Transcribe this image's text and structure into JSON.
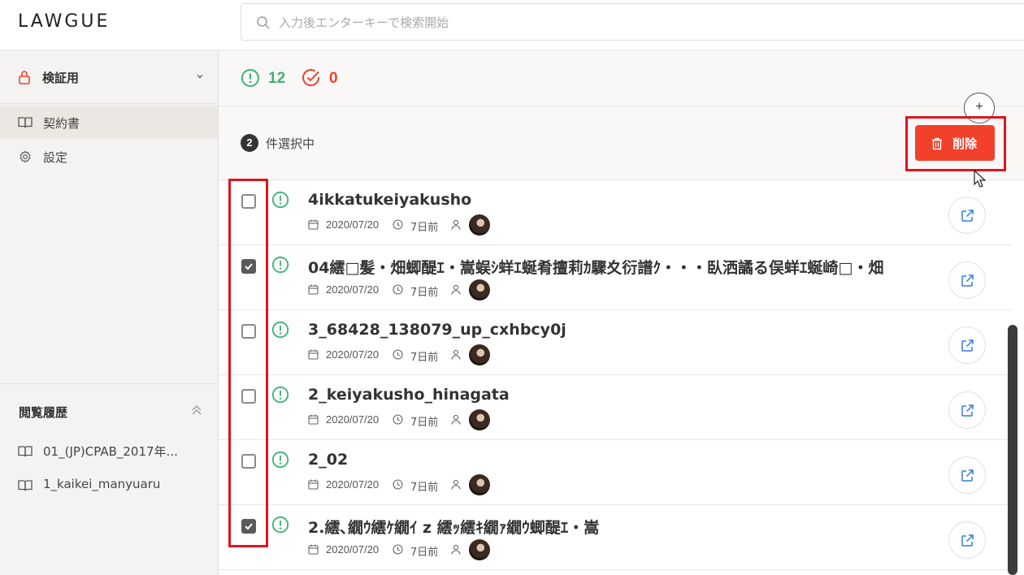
{
  "app": {
    "logo": "LAWGUE"
  },
  "search": {
    "placeholder": "入力後エンターキーで検索開始"
  },
  "sidebar": {
    "workspace": "検証用",
    "items": [
      {
        "label": "契約書",
        "icon": "book-icon",
        "active": true
      },
      {
        "label": "設定",
        "icon": "gear-icon",
        "active": false
      }
    ],
    "history": {
      "title": "閲覧履歴",
      "items": [
        {
          "label": "01_(JP)CPAB_2017年..."
        },
        {
          "label": "1_kaikei_manyuaru"
        }
      ]
    }
  },
  "stats": {
    "open_count": "12",
    "done_count": "0"
  },
  "selection": {
    "count": "2",
    "label": "件選択中",
    "add_label": "+",
    "delete_label": "削除"
  },
  "documents": [
    {
      "title": "4ikkatukeiyakusho",
      "date": "2020/07/20",
      "ago": "7日前",
      "checked": false
    },
    {
      "title": "04繧□髪・畑蝍醍ｴ・嵩蜈ｼ蛘ｴ蜒肴擅莉ｶ驟夊衍譜ｸ・・・臥洒譎る俣蛘ｴ蜒崎□・畑",
      "date": "2020/07/20",
      "ago": "7日前",
      "checked": true
    },
    {
      "title": "3_68428_138079_up_cxhbcy0j",
      "date": "2020/07/20",
      "ago": "7日前",
      "checked": false
    },
    {
      "title": "2_keiyakusho_hinagata",
      "date": "2020/07/20",
      "ago": "7日前",
      "checked": false
    },
    {
      "title": "2_02",
      "date": "2020/07/20",
      "ago": "7日前",
      "checked": false
    },
    {
      "title": "2.繧､繝ｳ繧ｹ繝ｲ z 繧ｯ繧ｷ繝ｧ繝ｳ蝍醍ｴ・嵩",
      "date": "2020/07/20",
      "ago": "7日前",
      "checked": true
    }
  ],
  "colors": {
    "accent_green": "#3cb371",
    "accent_red": "#f2412b",
    "highlight": "#e0141e"
  }
}
